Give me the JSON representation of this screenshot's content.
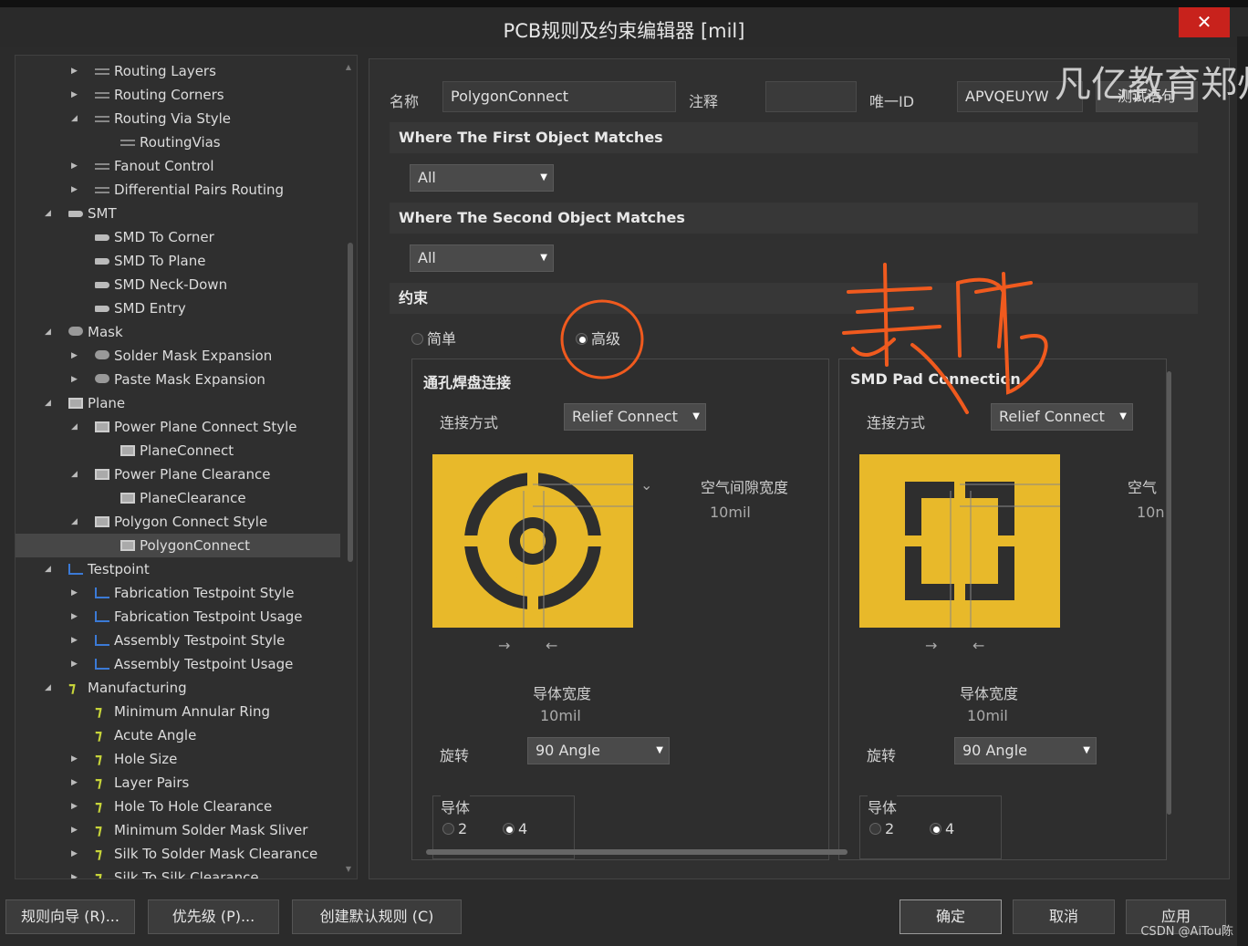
{
  "window": {
    "title": "PCB规则及约束编辑器 [mil]",
    "close": "✕"
  },
  "watermark": "凡亿教育郑州",
  "tree": {
    "items": [
      {
        "label": "Routing Layers",
        "level": 2,
        "icon": "routing-icon",
        "expander": "right"
      },
      {
        "label": "Routing Corners",
        "level": 2,
        "icon": "routing-icon",
        "expander": "right"
      },
      {
        "label": "Routing Via Style",
        "level": 2,
        "icon": "routing-icon",
        "expander": "down"
      },
      {
        "label": "RoutingVias",
        "level": 3,
        "icon": "routing-icon",
        "expander": ""
      },
      {
        "label": "Fanout Control",
        "level": 2,
        "icon": "routing-icon",
        "expander": "right"
      },
      {
        "label": "Differential Pairs Routing",
        "level": 2,
        "icon": "routing-icon",
        "expander": "right"
      },
      {
        "label": "SMT",
        "level": 1,
        "icon": "smd-icon",
        "expander": "down"
      },
      {
        "label": "SMD To Corner",
        "level": 2,
        "icon": "smd-icon",
        "expander": ""
      },
      {
        "label": "SMD To Plane",
        "level": 2,
        "icon": "smd-icon",
        "expander": ""
      },
      {
        "label": "SMD Neck-Down",
        "level": 2,
        "icon": "smd-icon",
        "expander": ""
      },
      {
        "label": "SMD Entry",
        "level": 2,
        "icon": "smd-icon",
        "expander": ""
      },
      {
        "label": "Mask",
        "level": 1,
        "icon": "mask-icon",
        "expander": "down"
      },
      {
        "label": "Solder Mask Expansion",
        "level": 2,
        "icon": "mask-icon",
        "expander": "right"
      },
      {
        "label": "Paste Mask Expansion",
        "level": 2,
        "icon": "mask-icon",
        "expander": "right"
      },
      {
        "label": "Plane",
        "level": 1,
        "icon": "plane-icon",
        "expander": "down"
      },
      {
        "label": "Power Plane Connect Style",
        "level": 2,
        "icon": "plane-icon",
        "expander": "down"
      },
      {
        "label": "PlaneConnect",
        "level": 3,
        "icon": "plane-icon",
        "expander": ""
      },
      {
        "label": "Power Plane Clearance",
        "level": 2,
        "icon": "plane-icon",
        "expander": "down"
      },
      {
        "label": "PlaneClearance",
        "level": 3,
        "icon": "plane-icon",
        "expander": ""
      },
      {
        "label": "Polygon Connect Style",
        "level": 2,
        "icon": "plane-icon",
        "expander": "down"
      },
      {
        "label": "PolygonConnect",
        "level": 3,
        "icon": "plane-icon",
        "expander": "",
        "selected": true
      },
      {
        "label": "Testpoint",
        "level": 1,
        "icon": "testpoint-icon",
        "expander": "down"
      },
      {
        "label": "Fabrication Testpoint Style",
        "level": 2,
        "icon": "testpoint-icon",
        "expander": "right"
      },
      {
        "label": "Fabrication Testpoint Usage",
        "level": 2,
        "icon": "testpoint-icon",
        "expander": "right"
      },
      {
        "label": "Assembly Testpoint Style",
        "level": 2,
        "icon": "testpoint-icon",
        "expander": "right"
      },
      {
        "label": "Assembly Testpoint Usage",
        "level": 2,
        "icon": "testpoint-icon",
        "expander": "right"
      },
      {
        "label": "Manufacturing",
        "level": 1,
        "icon": "manufacturing-icon",
        "expander": "down"
      },
      {
        "label": "Minimum Annular Ring",
        "level": 2,
        "icon": "manufacturing-icon",
        "expander": ""
      },
      {
        "label": "Acute Angle",
        "level": 2,
        "icon": "manufacturing-icon",
        "expander": ""
      },
      {
        "label": "Hole Size",
        "level": 2,
        "icon": "manufacturing-icon",
        "expander": "right"
      },
      {
        "label": "Layer Pairs",
        "level": 2,
        "icon": "manufacturing-icon",
        "expander": "right"
      },
      {
        "label": "Hole To Hole Clearance",
        "level": 2,
        "icon": "manufacturing-icon",
        "expander": "right"
      },
      {
        "label": "Minimum Solder Mask Sliver",
        "level": 2,
        "icon": "manufacturing-icon",
        "expander": "right"
      },
      {
        "label": "Silk To Solder Mask Clearance",
        "level": 2,
        "icon": "manufacturing-icon",
        "expander": "right"
      },
      {
        "label": "Silk To Silk Clearance",
        "level": 2,
        "icon": "manufacturing-icon",
        "expander": "right"
      }
    ]
  },
  "rule": {
    "name_label": "名称",
    "name_value": "PolygonConnect",
    "comment_label": "注释",
    "comment_value": "",
    "uid_label": "唯一ID",
    "uid_value": "APVQEUYW",
    "test_button": "测试语句"
  },
  "first_match": {
    "title": "Where The First Object Matches",
    "value": "All"
  },
  "second_match": {
    "title": "Where The Second Object Matches",
    "value": "All"
  },
  "constraints": {
    "title": "约束",
    "mode_simple": "简单",
    "mode_advanced": "高级",
    "selected_mode": "advanced"
  },
  "via_panel": {
    "title": "通孔焊盘连接",
    "connect_label": "连接方式",
    "connect_value": "Relief Connect",
    "air_gap_label": "空气间隙宽度",
    "air_gap_value": "10mil",
    "conductor_width_label": "导体宽度",
    "conductor_width_value": "10mil",
    "rotation_label": "旋转",
    "rotation_value": "90 Angle",
    "conductors_label": "导体",
    "conductors_opt1": "2",
    "conductors_opt2": "4",
    "conductors_selected": "4"
  },
  "smd_panel": {
    "title": "SMD Pad Connection",
    "connect_label": "连接方式",
    "connect_value": "Relief Connect",
    "air_gap_label": "空气",
    "air_gap_value": "10n",
    "conductor_width_label": "导体宽度",
    "conductor_width_value": "10mil",
    "rotation_label": "旋转",
    "rotation_value": "90 Angle",
    "conductors_label": "导体",
    "conductors_opt1": "2",
    "conductors_opt2": "4",
    "conductors_selected": "4"
  },
  "annotation": {
    "handwriting": "表贴",
    "color": "#f05a1e"
  },
  "buttons": {
    "wizard": "规则向导 (R)...",
    "priority": "优先级 (P)...",
    "create_default": "创建默认规则 (C)",
    "ok": "确定",
    "cancel": "取消",
    "apply": "应用"
  },
  "credit": "CSDN @AiTou陈",
  "colors": {
    "pad_yellow": "#e8b92a",
    "close_red": "#c8221c"
  }
}
